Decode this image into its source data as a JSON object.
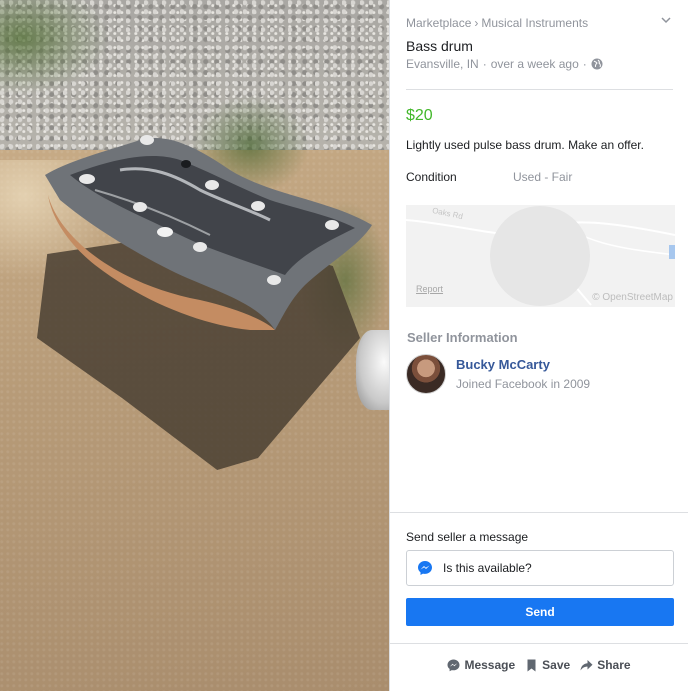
{
  "breadcrumb": {
    "root": "Marketplace",
    "separator": "›",
    "category": "Musical Instruments"
  },
  "listing": {
    "title": "Bass drum",
    "location": "Evansville, IN",
    "posted": "over a week ago",
    "price": "$20",
    "description": "Lightly used pulse bass drum. Make an offer.",
    "condition_label": "Condition",
    "condition_value": "Used - Fair"
  },
  "map": {
    "road_label": "Oaks Rd",
    "report_label": "Report",
    "attribution": "© OpenStreetMap"
  },
  "seller": {
    "heading": "Seller Information",
    "name": "Bucky McCarty",
    "joined": "Joined Facebook in 2009"
  },
  "message": {
    "heading": "Send seller a message",
    "input_value": "Is this available?",
    "send_label": "Send"
  },
  "actions": {
    "message_label": "Message",
    "save_label": "Save",
    "share_label": "Share"
  },
  "colors": {
    "price": "#42b72a",
    "send_button": "#1877f2",
    "link": "#365899",
    "muted": "#90949c"
  },
  "icons": {
    "collapse": "chevron-down-icon",
    "privacy": "globe-icon",
    "messenger": "messenger-icon",
    "message": "message-icon",
    "save": "bookmark-icon",
    "share": "share-icon"
  }
}
